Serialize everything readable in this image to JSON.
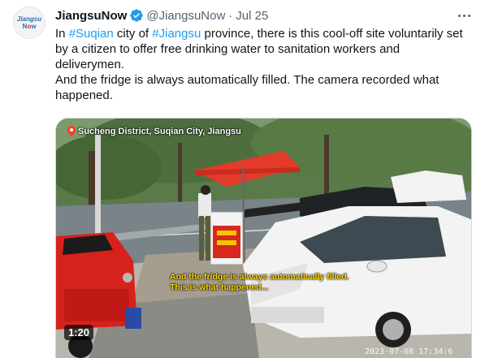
{
  "account": {
    "avatar_line1": "Jiangsu",
    "avatar_line2a": "N",
    "avatar_line2b": "o",
    "avatar_line2c": "w",
    "display_name": "JiangsuNow",
    "handle": "@JiangsuNow",
    "separator": "·",
    "date": "Jul 25",
    "verified_icon": "verified-badge-icon",
    "colors": {
      "verified": "#1d9bf0",
      "hashtag": "#1d9bf0"
    }
  },
  "tweet": {
    "p1_a": "In ",
    "p1_tag1": "#Suqian",
    "p1_b": " city of ",
    "p1_tag2": "#Jiangsu",
    "p1_c": " province, there is this cool-off site voluntarily set by a citizen to offer free drinking water to sanitation workers and deliverymen.",
    "p2": "And the fridge is always automatically filled. The camera recorded what happened."
  },
  "video": {
    "location": "Sucheng District, Suqian City, Jiangsu",
    "caption_line1": "And the fridge is always automatically filled.",
    "caption_line2": "This is what happened...",
    "duration": "1:20",
    "timestamp": "2023-07-08 17:34:6"
  }
}
